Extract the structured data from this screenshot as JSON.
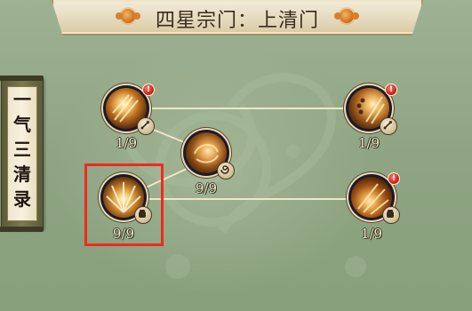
{
  "title": "四星宗门：上清门",
  "side_scroll": {
    "chars": [
      "一",
      "气",
      "三",
      "清",
      "录"
    ]
  },
  "skills": [
    {
      "id": "top-left",
      "progress": "1/9",
      "badge": "!",
      "tag_icon": "sword-icon"
    },
    {
      "id": "middle",
      "progress": "9/9",
      "tag_icon": "swirl-icon"
    },
    {
      "id": "bottom-left",
      "progress": "9/9",
      "tag_icon": "fist-icon",
      "selected": true
    },
    {
      "id": "top-right",
      "progress": "1/9",
      "badge": "!",
      "tag_icon": "sword-icon"
    },
    {
      "id": "bottom-right",
      "progress": "1/9",
      "badge": "!",
      "tag_icon": "fist-icon"
    }
  ],
  "colors": {
    "selection": "#ef2a21",
    "badge": "#c21a12",
    "link": "#efe6c8"
  }
}
